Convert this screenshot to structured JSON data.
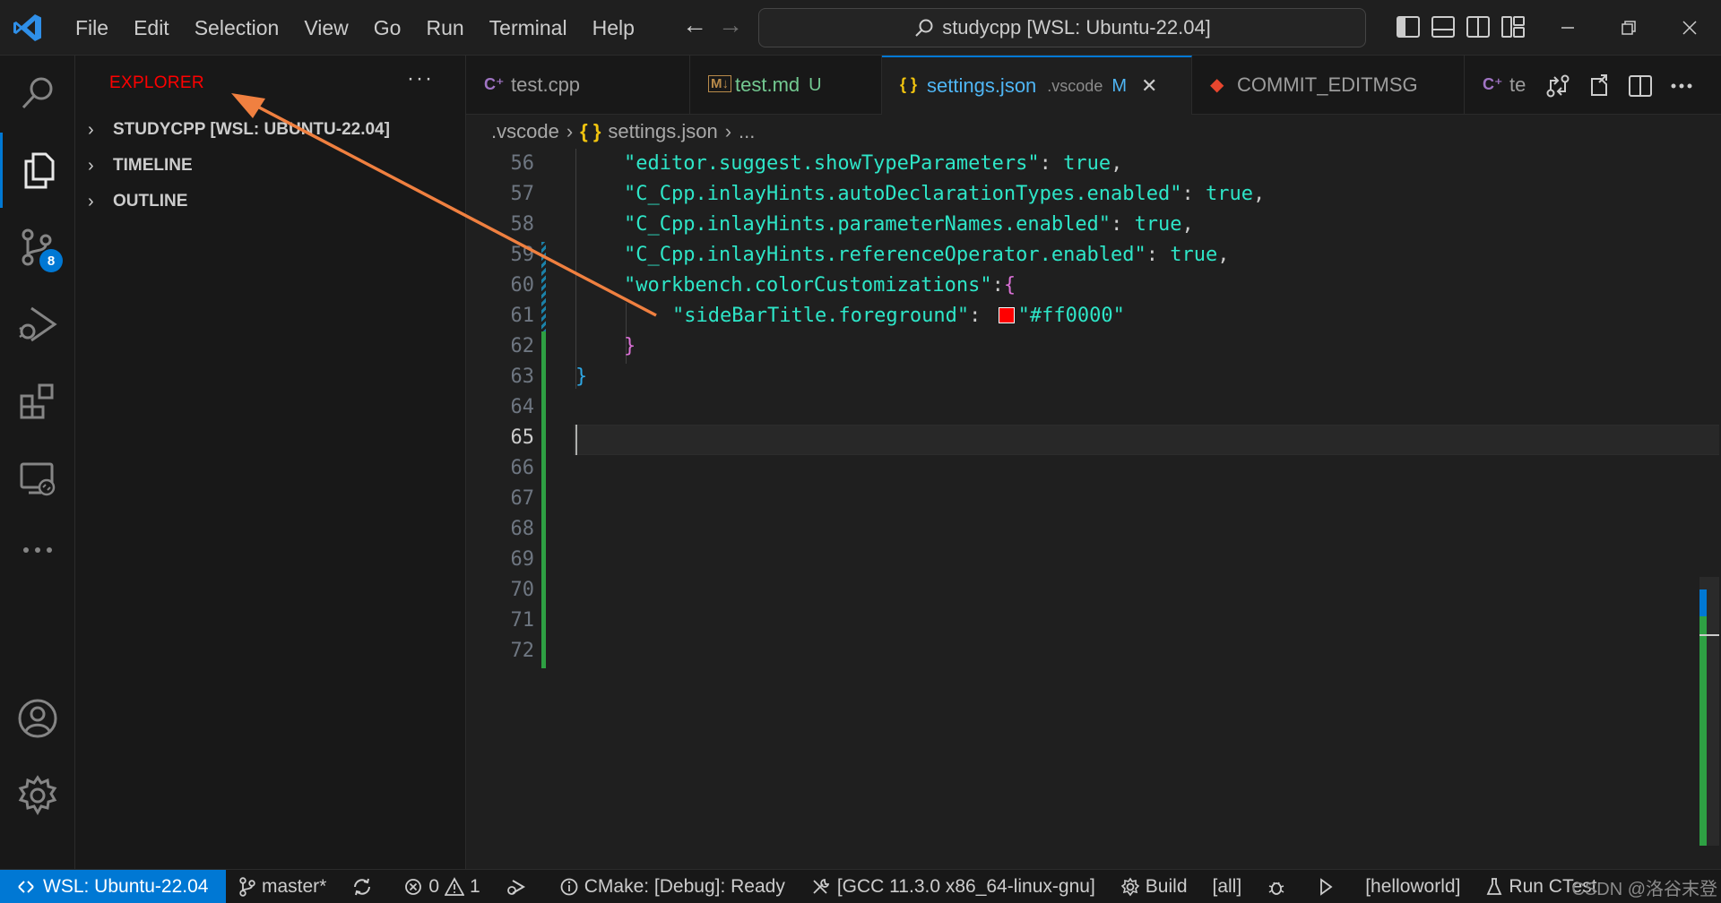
{
  "titlebar": {
    "menu": [
      "File",
      "Edit",
      "Selection",
      "View",
      "Go",
      "Run",
      "Terminal",
      "Help"
    ],
    "command_center": "studycpp [WSL: Ubuntu-22.04]"
  },
  "activitybar": {
    "icons": [
      "search-icon",
      "files-icon",
      "source-control-icon",
      "run-debug-icon",
      "extensions-icon",
      "remote-explorer-icon",
      "more-icon",
      "account-icon",
      "settings-gear-icon"
    ],
    "scm_badge": "8"
  },
  "sidebar": {
    "title": "EXPLORER",
    "title_color": "#ff0000",
    "more": "···",
    "sections": [
      {
        "label": "STUDYCPP [WSL: UBUNTU-22.04]"
      },
      {
        "label": "TIMELINE"
      },
      {
        "label": "OUTLINE"
      }
    ]
  },
  "tabs": [
    {
      "icon": "C⁺",
      "label": "test.cpp",
      "desc": "",
      "status": "",
      "color": "#9d9d9d"
    },
    {
      "icon": "M↓",
      "label": "test.md",
      "desc": "",
      "status": "U",
      "color": "#73c991"
    },
    {
      "icon": "{ }",
      "label": "settings.json",
      "desc": ".vscode",
      "status": "M",
      "color": "#4fb6f5"
    },
    {
      "icon": "◆",
      "label": "COMMIT_EDITMSG",
      "desc": "",
      "status": "",
      "color": "#9d9d9d"
    },
    {
      "icon": "C⁺",
      "label": "te",
      "desc": "",
      "status": "",
      "color": "#9d9d9d"
    }
  ],
  "breadcrumb": {
    "folder": ".vscode",
    "file": "settings.json",
    "more": "..."
  },
  "editor": {
    "line_numbers": [
      "56",
      "57",
      "58",
      "59",
      "60",
      "61",
      "62",
      "63",
      "64",
      "65",
      "66",
      "67",
      "68",
      "69",
      "70",
      "71",
      "72"
    ],
    "current_line": "65",
    "lines": {
      "l56_key": "\"editor.suggest.showTypeParameters\"",
      "l57_key": "\"C_Cpp.inlayHints.autoDeclarationTypes.enabled\"",
      "l58_key": "\"C_Cpp.inlayHints.parameterNames.enabled\"",
      "l59_key": "\"C_Cpp.inlayHints.referenceOperator.enabled\"",
      "l60_key": "\"workbench.colorCustomizations\"",
      "l61_key": "\"sideBarTitle.foreground\"",
      "l61_val": "\"#ff0000\"",
      "true": "true",
      "colon": ": ",
      "comma": ",",
      "open_brace": "{",
      "close_brace": "}"
    }
  },
  "statusbar": {
    "remote": "WSL: Ubuntu-22.04",
    "branch": "master*",
    "errors": "0",
    "warnings": "1",
    "cmake": "CMake: [Debug]: Ready",
    "kit": "[GCC 11.3.0 x86_64-linux-gnu]",
    "build": "Build",
    "target": "[all]",
    "launch_target": "[helloworld]",
    "ctest": "Run CTest"
  },
  "watermark": "CSDN @洛谷末登"
}
